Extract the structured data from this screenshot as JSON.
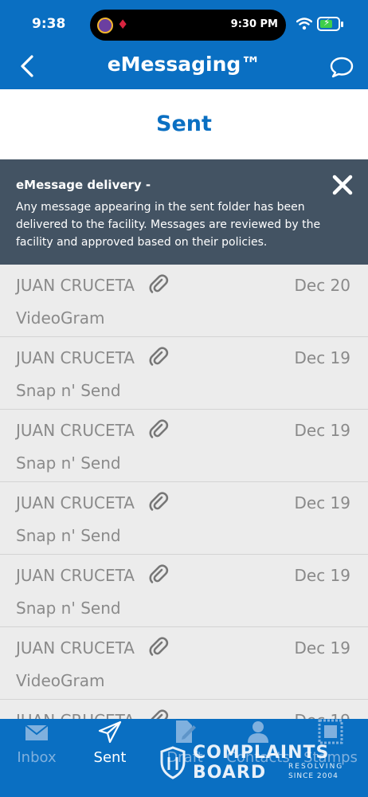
{
  "status_bar": {
    "time": "9:38",
    "island_time": "9:30 PM"
  },
  "header": {
    "title": "eMessaging™",
    "back_icon": "chevron-left-icon",
    "chat_icon": "chat-bubble-icon"
  },
  "section": {
    "title": "Sent"
  },
  "notice": {
    "title": "eMessage delivery -",
    "body": "Any message appearing in the sent folder has been delivered to the facility. Messages are reviewed by the facility and approved based on their policies.",
    "close_icon": "close-icon"
  },
  "messages": [
    {
      "name": "JUAN CRUCETA",
      "date": "Dec 20",
      "subject": "VideoGram",
      "attachment_icon": "paperclip-icon"
    },
    {
      "name": "JUAN CRUCETA",
      "date": "Dec 19",
      "subject": "Snap n' Send",
      "attachment_icon": "paperclip-icon"
    },
    {
      "name": "JUAN CRUCETA",
      "date": "Dec 19",
      "subject": "Snap n' Send",
      "attachment_icon": "paperclip-icon"
    },
    {
      "name": "JUAN CRUCETA",
      "date": "Dec 19",
      "subject": "Snap n' Send",
      "attachment_icon": "paperclip-icon"
    },
    {
      "name": "JUAN CRUCETA",
      "date": "Dec 19",
      "subject": "Snap n' Send",
      "attachment_icon": "paperclip-icon"
    },
    {
      "name": "JUAN CRUCETA",
      "date": "Dec 19",
      "subject": "VideoGram",
      "attachment_icon": "paperclip-icon"
    },
    {
      "name": "JUAN CRUCETA",
      "date": "Dec 19",
      "subject": "",
      "attachment_icon": "paperclip-icon"
    }
  ],
  "tabs": [
    {
      "label": "Inbox",
      "icon": "envelope-icon",
      "active": false
    },
    {
      "label": "Sent",
      "icon": "paper-plane-icon",
      "active": true
    },
    {
      "label": "Draft",
      "icon": "document-edit-icon",
      "active": false
    },
    {
      "label": "Contacts",
      "icon": "person-icon",
      "active": false
    },
    {
      "label": "Stamps",
      "icon": "stamp-icon",
      "active": false
    }
  ],
  "watermark": {
    "line1": "COMPLAINTS",
    "line2": "BOARD",
    "tag1": "RESOLVING",
    "tag2": "SINCE 2004"
  },
  "colors": {
    "brand_blue": "#0a6fc2",
    "banner_bg": "#435363",
    "list_bg": "#ececec",
    "muted_text": "#8a8a8a"
  }
}
